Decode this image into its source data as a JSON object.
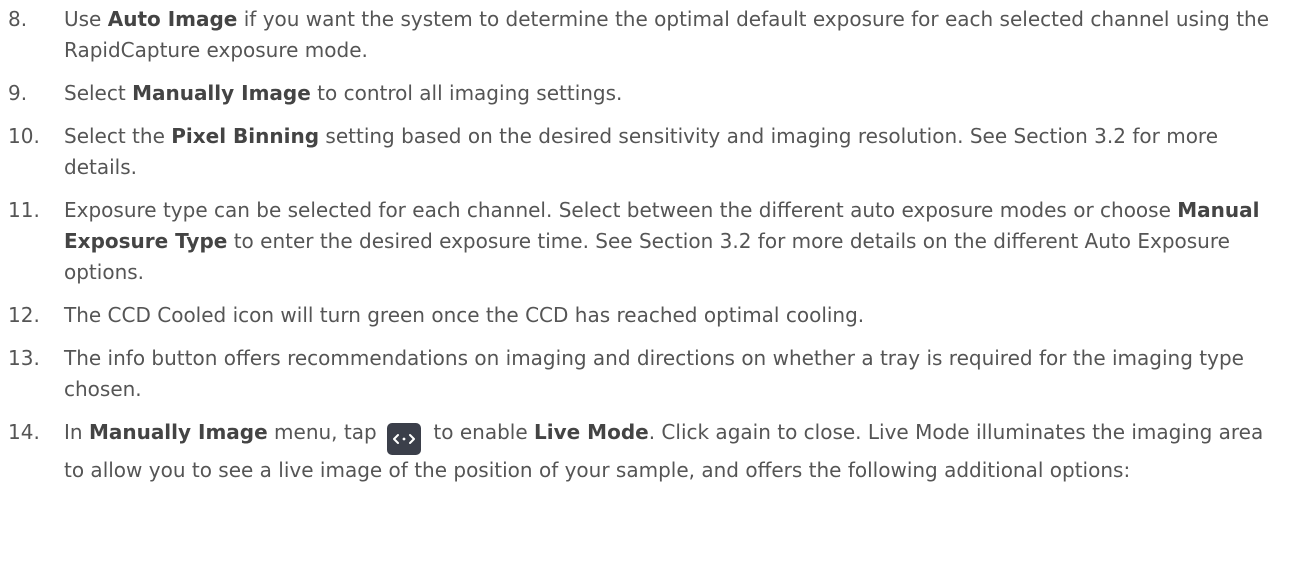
{
  "items": [
    {
      "num": "8.",
      "parts": [
        "Use ",
        "Auto Image",
        " if you want the system to determine the optimal default exposure for each selected channel using the RapidCapture exposure mode."
      ]
    },
    {
      "num": "9.",
      "parts": [
        "Select ",
        "Manually Image",
        " to control all imaging settings."
      ]
    },
    {
      "num": "10.",
      "parts": [
        "Select the ",
        "Pixel Binning",
        " setting based on the desired sensitivity and imaging resolution. See Section 3.2 for more details."
      ]
    },
    {
      "num": "11.",
      "parts": [
        "Exposure type can be selected for each channel. Select between the different auto exposure modes or choose ",
        "Manual Exposure Type",
        " to enter the desired exposure time. See Section 3.2 for more details on the different Auto Exposure options."
      ]
    },
    {
      "num": "12.",
      "parts": [
        "The CCD Cooled icon will turn green once the CCD has reached optimal cooling."
      ]
    },
    {
      "num": "13.",
      "parts": [
        "The info button offers recommendations on imaging and directions on whether a tray is required for the imaging type chosen."
      ]
    },
    {
      "num": "14.",
      "parts": [
        "In ",
        "Manually Image",
        " menu, tap ",
        " to enable ",
        "Live Mode",
        ". Click again to close. Live Mode illuminates the imaging area to allow you to see a live image of the position of your sample, and offers the following additional options:"
      ]
    }
  ],
  "icons": {
    "live_mode": "live-mode-icon"
  }
}
